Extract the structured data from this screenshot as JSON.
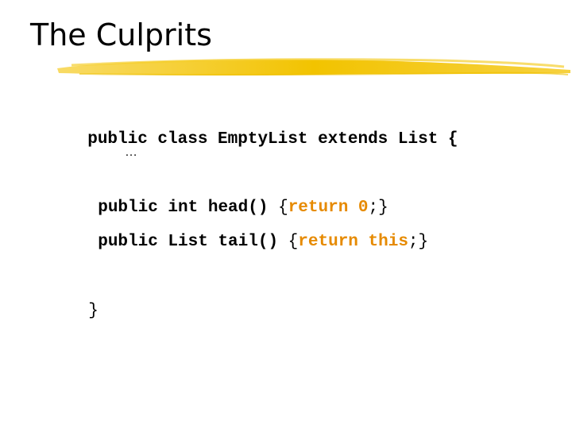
{
  "slide": {
    "title": "The Culprits"
  },
  "code": {
    "line1": "public class EmptyList extends List {",
    "ellipsis": "…",
    "line2": {
      "pre": "public int head",
      "parens": "()",
      "open": " {",
      "ret": "return 0",
      "close": ";}"
    },
    "line3": {
      "pre": "public List tail",
      "parens": "()",
      "open": " {",
      "ret": "return this",
      "close": ";}"
    },
    "closing_brace": "}"
  },
  "colors": {
    "keyword_highlight": "#E68A00",
    "underline_stroke": "#F2C300"
  }
}
